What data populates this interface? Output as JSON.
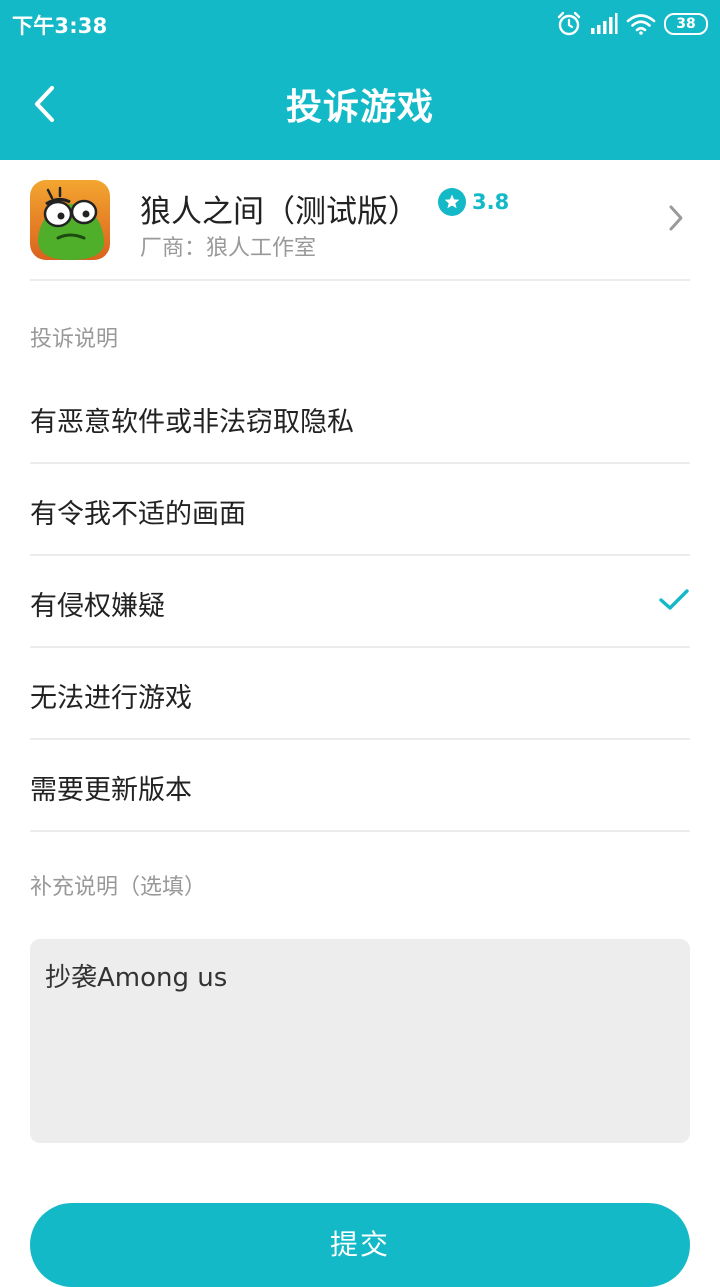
{
  "status_bar": {
    "time": "下午3:38",
    "battery": "38",
    "icons": [
      "alarm-icon",
      "signal-icon",
      "wifi-icon",
      "battery-icon"
    ]
  },
  "header": {
    "title": "投诉游戏",
    "back_icon": "chevron-left-icon"
  },
  "game": {
    "name": "狼人之间（测试版）",
    "rating": "3.8",
    "vendor": "厂商：狼人工作室",
    "rating_icon": "star-icon"
  },
  "complaint": {
    "section_label": "投诉说明",
    "options": [
      {
        "label": "有恶意软件或非法窃取隐私",
        "selected": false
      },
      {
        "label": "有令我不适的画面",
        "selected": false
      },
      {
        "label": "有侵权嫌疑",
        "selected": true
      },
      {
        "label": "无法进行游戏",
        "selected": false
      },
      {
        "label": "需要更新版本",
        "selected": false
      }
    ]
  },
  "supplement": {
    "label": "补充说明（选填）",
    "value": "抄袭Among us"
  },
  "submit_label": "提交",
  "colors": {
    "accent": "#13b9c7",
    "divider": "#ececec",
    "muted_text": "#999999",
    "textarea_bg": "#ededed"
  }
}
